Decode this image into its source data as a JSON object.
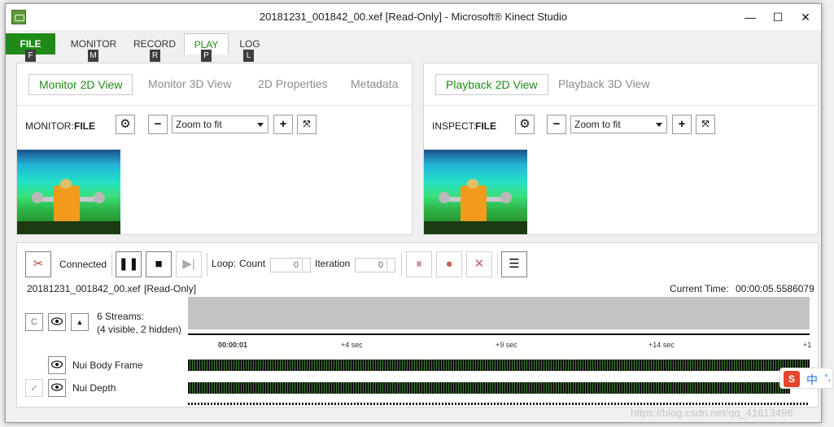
{
  "window": {
    "title": "20181231_001842_00.xef [Read-Only] - Microsoft® Kinect Studio",
    "min": "—",
    "max": "☐",
    "close": "✕"
  },
  "menu": {
    "tabs": [
      {
        "label": "FILE",
        "key": "F"
      },
      {
        "label": "MONITOR",
        "key": "M"
      },
      {
        "label": "RECORD",
        "key": "R"
      },
      {
        "label": "PLAY",
        "key": "P"
      },
      {
        "label": "LOG",
        "key": "L"
      }
    ]
  },
  "left_panel": {
    "tabs": [
      "Monitor 2D View",
      "Monitor 3D View",
      "2D Properties",
      "Metadata"
    ],
    "source_label": "MONITOR:",
    "source_value": "FILE",
    "zoom": "Zoom to fit"
  },
  "right_panel": {
    "tabs": [
      "Playback 2D View",
      "Playback 3D View"
    ],
    "source_label": "INSPECT:",
    "source_value": "FILE",
    "zoom": "Zoom to fit"
  },
  "playback": {
    "status": "Connected",
    "loop_label": "Loop:",
    "count_label": "Count",
    "count_value": "0",
    "iteration_label": "Iteration",
    "iteration_value": "0",
    "file_name": "20181231_001842_00.xef",
    "read_only": "[Read-Only]",
    "current_time_label": "Current Time:",
    "current_time": "00:00:05.5586079",
    "c_label": "C",
    "streams_line1": "6 Streams:",
    "streams_line2": "(4 visible, 2 hidden)",
    "ticks": [
      "00:00:01",
      "+4 sec",
      "+9 sec",
      "+14 sec",
      "+1"
    ],
    "streams": [
      {
        "name": "Nui Body Frame"
      },
      {
        "name": "Nui Depth"
      }
    ]
  },
  "ime": {
    "label": "中"
  },
  "watermark": "https://blog.csdn.net/qq_41613496",
  "colors": {
    "accent": "#1e8a17",
    "file_tab": "#1e8a17"
  }
}
